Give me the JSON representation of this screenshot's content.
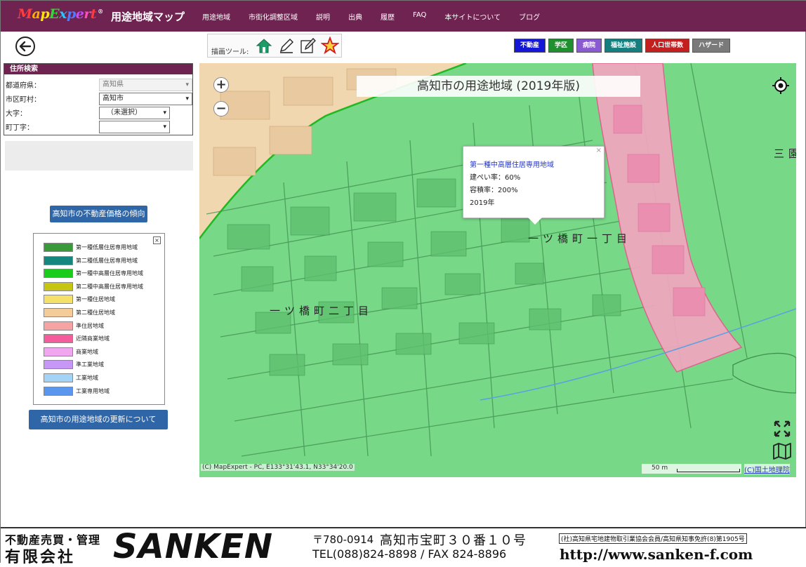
{
  "header": {
    "logo_text": "MapExpert",
    "logo_mark": "®",
    "app_title": "用途地域マップ",
    "nav": [
      "用途地域",
      "市街化調整区域",
      "説明",
      "出典",
      "履歴",
      "FAQ",
      "本サイトについて",
      "ブログ"
    ]
  },
  "toolbar": {
    "draw_label": "描画ツール:",
    "layers": [
      {
        "label": "不動産",
        "color": "#1417d6"
      },
      {
        "label": "学区",
        "color": "#1f8f2f"
      },
      {
        "label": "病院",
        "color": "#8a5ad1"
      },
      {
        "label": "福祉施設",
        "color": "#157f7f"
      },
      {
        "label": "人口世帯数",
        "color": "#c41f1f"
      },
      {
        "label": "ハザード",
        "color": "#7a7a7a"
      }
    ]
  },
  "address_search": {
    "title": "住所検索",
    "prefecture_label": "都道府県：",
    "prefecture_value": "高知県",
    "city_label": "市区町村：",
    "city_value": "高知市",
    "oaza_label": "大字：",
    "oaza_value": "（未選択）",
    "chome_label": "町丁字：",
    "chome_value": ""
  },
  "buttons": {
    "price_trend": "高知市の不動産価格の傾向",
    "zoning_update": "高知市の用途地域の更新について"
  },
  "legend": {
    "close": "×",
    "items": [
      {
        "label": "第一種低層住居専用地域",
        "color": "#3a9a3a"
      },
      {
        "label": "第二種低層住居専用地域",
        "color": "#15877e"
      },
      {
        "label": "第一種中高層住居専用地域",
        "color": "#1ccc1c"
      },
      {
        "label": "第二種中高層住居専用地域",
        "color": "#c6c612"
      },
      {
        "label": "第一種住居地域",
        "color": "#f5e06a"
      },
      {
        "label": "第二種住居地域",
        "color": "#f4cc9a"
      },
      {
        "label": "準住居地域",
        "color": "#f7a3a3"
      },
      {
        "label": "近隣商業地域",
        "color": "#f45c9c"
      },
      {
        "label": "商業地域",
        "color": "#f3a6f0"
      },
      {
        "label": "準工業地域",
        "color": "#c797f5"
      },
      {
        "label": "工業地域",
        "color": "#a3d4f7"
      },
      {
        "label": "工業専用地域",
        "color": "#5b96ee"
      }
    ]
  },
  "map": {
    "title": "高知市の用途地域 (2019年版)",
    "zoom_in": "+",
    "zoom_out": "−",
    "popup": {
      "zone": "第一種中高層住居専用地域",
      "coverage": "建ぺい率：60%",
      "far": "容積率：200%",
      "year": "2019年",
      "close": "×"
    },
    "labels": {
      "area1": "一ツ橋町一丁目",
      "area2": "一ツ橋町二丁目",
      "area3": "三園"
    },
    "attribution": "(C) MapExpert - PC, E133°31'43.1, N33°34'20.0",
    "scale": "50 m",
    "gsi_link": "(C)国土地理院"
  },
  "footer": {
    "line1_left": "不動産売買・管理",
    "line2_left": "有限会社",
    "brand": "SANKEN",
    "postal": "〒780-0914",
    "address": "高知市宝町３０番１０号",
    "association": "(社)高知県宅地建物取引業協会会員/高知県知事免許(8)第1905号",
    "tel": "TEL(088)824-8898 / FAX 824-8896",
    "url": "http://www.sanken-f.com"
  },
  "icons": {
    "back": "back-arrow-icon",
    "house": "house-icon",
    "pencil": "pencil-icon",
    "pencil_box": "edit-icon",
    "star": "star-icon",
    "locate": "locate-icon",
    "fullscreen": "fullscreen-icon",
    "map": "map-layers-icon"
  }
}
